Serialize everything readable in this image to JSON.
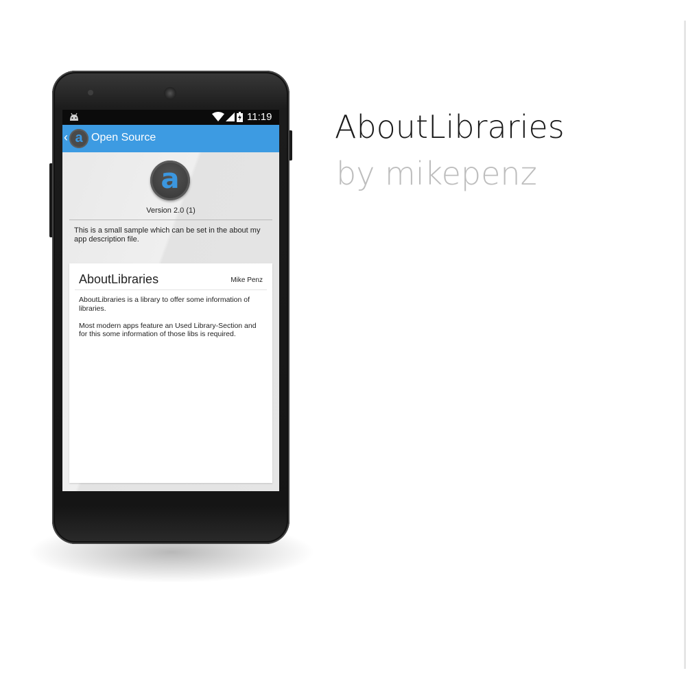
{
  "promo": {
    "title": "AboutLibraries",
    "subtitle": "by mikepenz"
  },
  "status_bar": {
    "time": "11:19",
    "icons": [
      "android-icon",
      "wifi-icon",
      "signal-icon",
      "battery-icon"
    ]
  },
  "action_bar": {
    "title": "Open Source",
    "color": "#3d9be2",
    "logo_letter": "a"
  },
  "app_header": {
    "logo_letter": "a",
    "version": "Version 2.0 (1)",
    "description": "This is a small sample which can be set in the about my app description file."
  },
  "libraries": [
    {
      "name": "AboutLibraries",
      "author": "Mike Penz",
      "description": "AboutLibraries is a library to offer some information of libraries.\n\n Most modern apps feature an Used Library-Section and for this some information of those libs is required."
    }
  ],
  "colors": {
    "accent": "#3d9be2",
    "logo_letter": "#3b97e0",
    "subtitle": "#bdbdbd"
  }
}
